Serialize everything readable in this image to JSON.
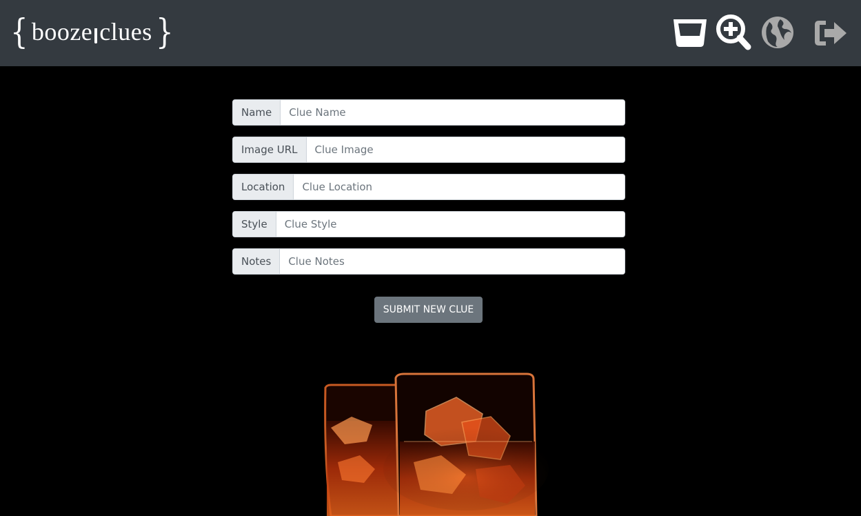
{
  "header": {
    "logo": {
      "open_brace": "{",
      "word_left": "booze",
      "word_right": "clues",
      "close_brace": "}"
    },
    "icons": [
      "glass-icon",
      "search-plus-icon",
      "globe-icon",
      "logout-icon"
    ]
  },
  "form": {
    "fields": [
      {
        "label": "Name",
        "placeholder": "Clue Name",
        "value": ""
      },
      {
        "label": "Image URL",
        "placeholder": "Clue Image",
        "value": ""
      },
      {
        "label": "Location",
        "placeholder": "Clue Location",
        "value": ""
      },
      {
        "label": "Style",
        "placeholder": "Clue Style",
        "value": ""
      },
      {
        "label": "Notes",
        "placeholder": "Clue Notes",
        "value": ""
      }
    ],
    "submit_label": "SUBMIT NEW CLUE"
  },
  "colors": {
    "navbar": "#343a40",
    "background": "#000000",
    "button": "#6c757d",
    "icon_active": "#ffffff",
    "icon_muted": "#a9a9a9"
  }
}
